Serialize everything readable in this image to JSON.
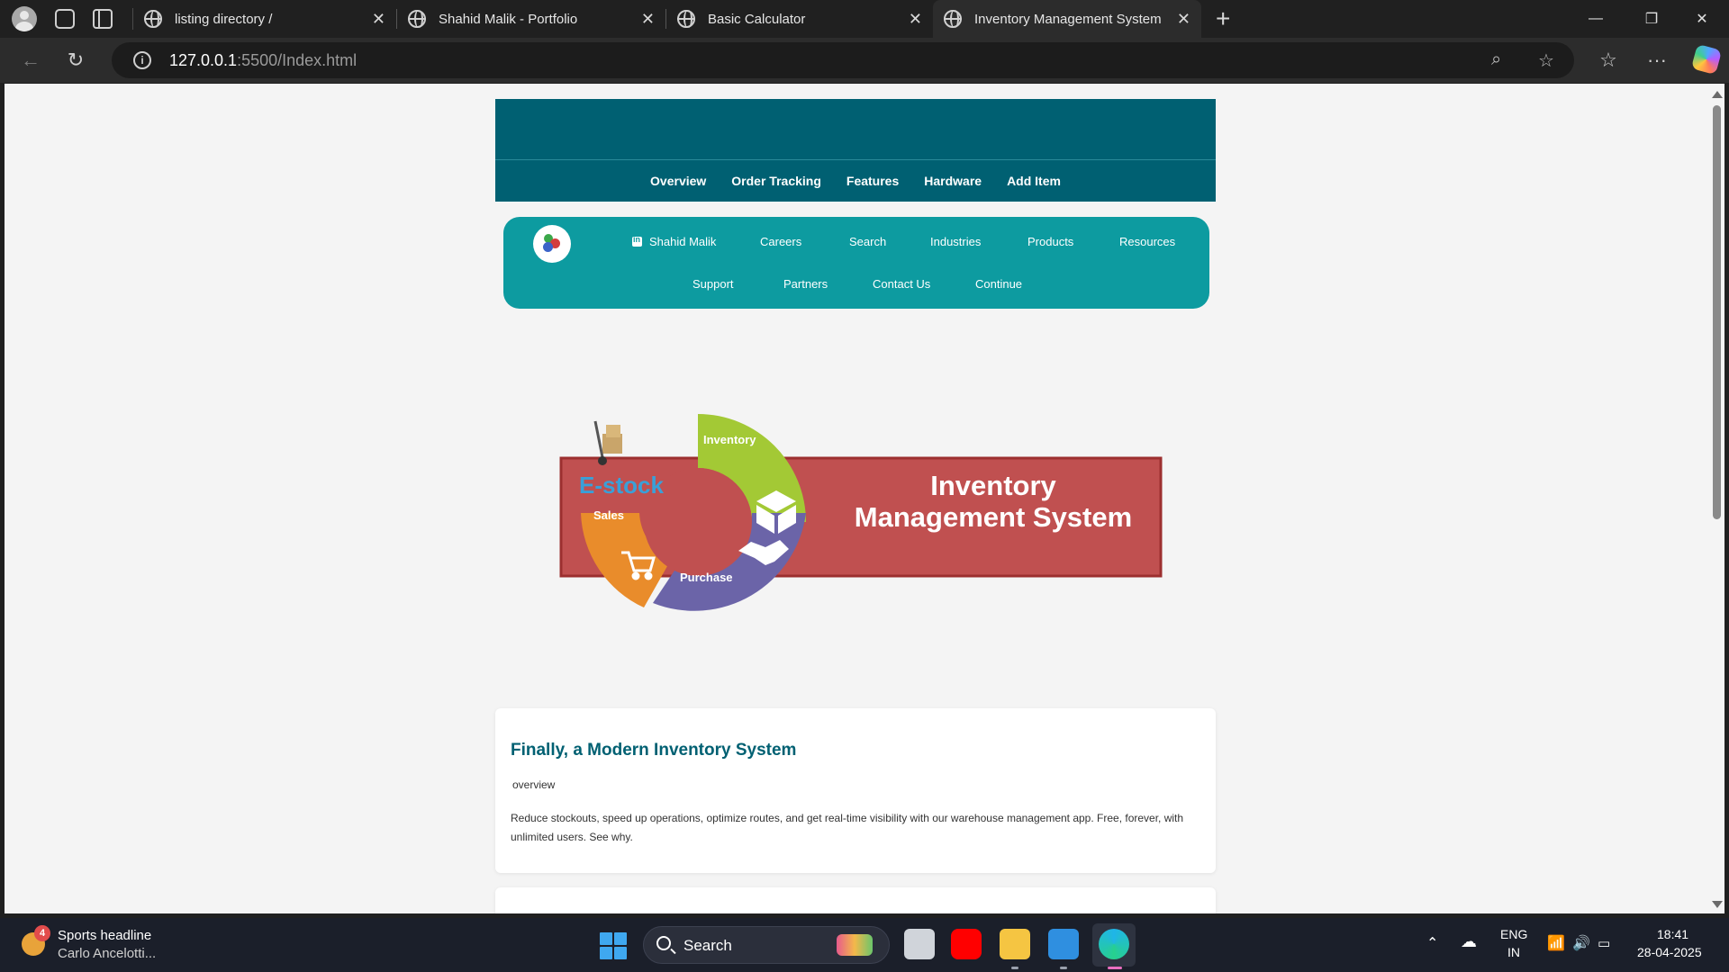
{
  "browser": {
    "tabs": [
      {
        "title": "listing directory /",
        "active": false
      },
      {
        "title": "Shahid Malik - Portfolio",
        "active": false
      },
      {
        "title": "Basic Calculator",
        "active": false
      },
      {
        "title": "Inventory Management System",
        "active": true
      }
    ],
    "url_host": "127.0.0.1",
    "url_rest": ":5500/Index.html"
  },
  "site": {
    "nav": [
      "Overview",
      "Order Tracking",
      "Features",
      "Hardware",
      "Add Item"
    ],
    "teal_nav": {
      "profile": "Shahid Malik",
      "row1": [
        "Careers",
        "Search",
        "Industries",
        "Products",
        "Resources"
      ],
      "row2": [
        "Support",
        "Partners",
        "Contact Us",
        "Continue"
      ]
    },
    "banner": {
      "brand": "E-stock",
      "title_line1": "Inventory",
      "title_line2": "Management System",
      "segments": [
        "Inventory",
        "Sales",
        "Purchase"
      ]
    },
    "card": {
      "heading": "Finally, a Modern Inventory System",
      "image_alt": "overview",
      "body": "Reduce stockouts, speed up operations, optimize routes, and get real-time visibility with our warehouse management app. Free, forever, with unlimited users. See why."
    }
  },
  "taskbar": {
    "news_badge": "4",
    "news_title": "Sports headline",
    "news_sub": "Carlo Ancelotti...",
    "search_label": "Search",
    "lang1": "ENG",
    "lang2": "IN",
    "time": "18:41",
    "date": "28-04-2025"
  },
  "colors": {
    "header": "#006072",
    "teal_bar": "#0d9ba0",
    "banner_red": "#c05050"
  }
}
